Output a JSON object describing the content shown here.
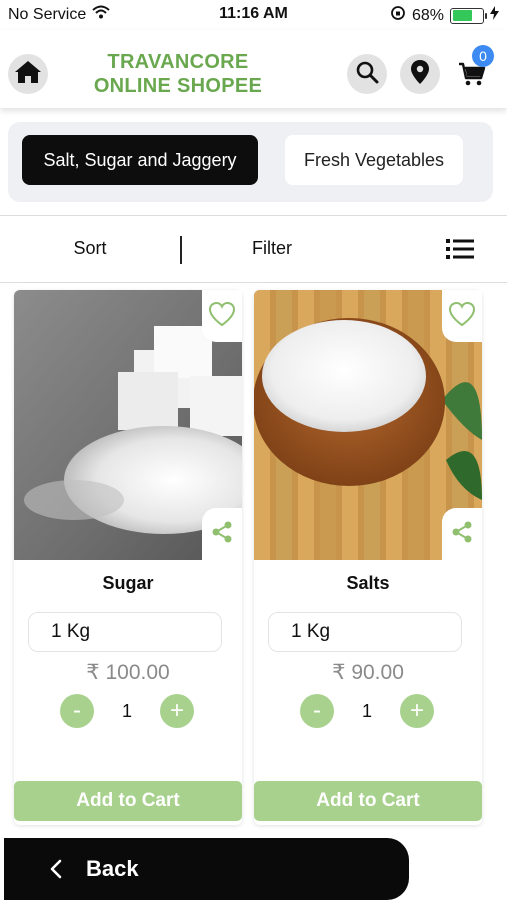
{
  "status_bar": {
    "carrier": "No Service",
    "time": "11:16 AM",
    "battery": "68%",
    "battery_level": 0.68,
    "icons": [
      "wifi-icon",
      "orientation-lock-icon",
      "battery-icon",
      "charging-icon"
    ]
  },
  "header": {
    "brand_line1": "TRAVANCORE",
    "brand_line2": "ONLINE SHOPEE",
    "cart_count": "0",
    "icons": [
      "home-icon",
      "search-icon",
      "location-pin-icon",
      "cart-icon"
    ]
  },
  "categories": [
    {
      "label": "Salt, Sugar and Jaggery",
      "active": true
    },
    {
      "label": "Fresh Vegetables",
      "active": false
    }
  ],
  "toolbar": {
    "sort_label": "Sort",
    "filter_label": "Filter",
    "icons": [
      "list-view-icon"
    ]
  },
  "products": [
    {
      "name": "Sugar",
      "quantity": "1 Kg",
      "price": "₹ 100.00",
      "count": "1",
      "add_label": "Add to Cart",
      "minus": "-",
      "plus": "+"
    },
    {
      "name": "Salts",
      "quantity": "1 Kg",
      "price": "₹ 90.00",
      "count": "1",
      "add_label": "Add to Cart",
      "minus": "-",
      "plus": "+"
    }
  ],
  "back": {
    "label": "Back"
  },
  "colors": {
    "brand_green": "#6aa84f",
    "light_green": "#a9d18e",
    "active_tab": "#0d0d0d",
    "badge_blue": "#3d8bf2"
  }
}
